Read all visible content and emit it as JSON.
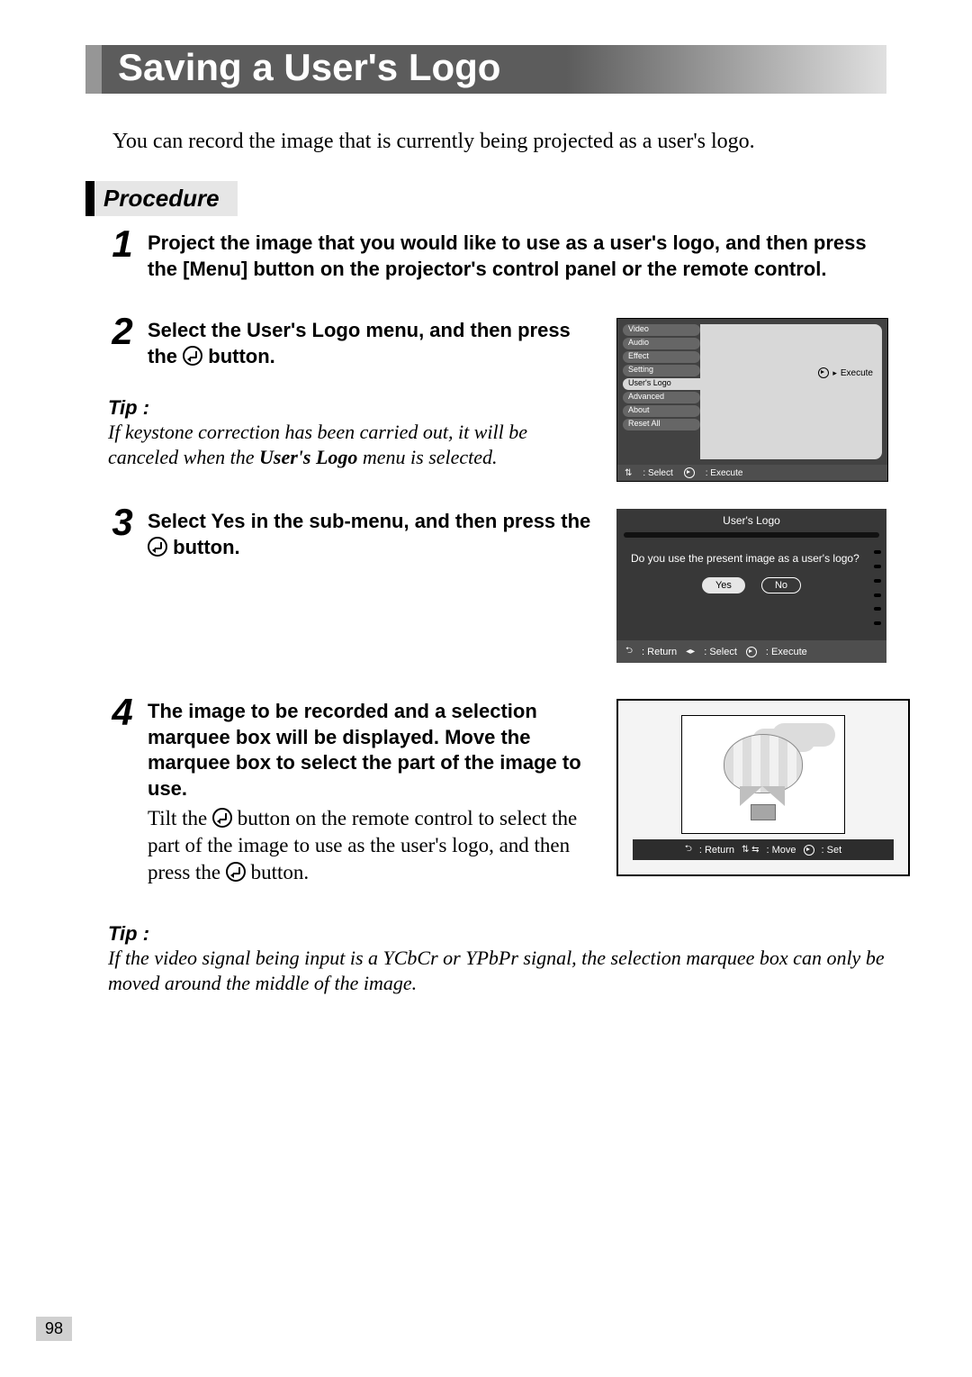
{
  "title": "Saving a User's Logo",
  "intro": "You can record the image that is currently being projected as a user's logo.",
  "procedure_label": "Procedure",
  "steps": {
    "s1": {
      "num": "1",
      "main": "Project the image that you would like to use as a user's logo, and then press the [Menu] button on the projector's control panel or the remote control."
    },
    "s2": {
      "num": "2",
      "main_a": "Select the User's Logo menu, and then press the ",
      "main_b": " button."
    },
    "s3": {
      "num": "3",
      "main_a": "Select Yes in the sub-menu, and then press the ",
      "main_b": " button."
    },
    "s4": {
      "num": "4",
      "main": "The image to be recorded and a selection marquee box will be displayed. Move the marquee box to select the part of the image to use.",
      "sub_a": "Tilt the ",
      "sub_b": " button on the remote control to select the part of the image to use as the user's logo, and then press the ",
      "sub_c": " button."
    }
  },
  "tips": {
    "label": "Tip :",
    "t1": "If keystone correction has been carried out, it will be canceled when the User's Logo menu is selected.",
    "t2": "If the video signal being input is a YCbCr or YPbPr signal, the selection marquee box can only be moved around the middle of the image."
  },
  "screen1": {
    "menu": [
      "Video",
      "Audio",
      "Effect",
      "Setting",
      "User's Logo",
      "Advanced",
      "About",
      "Reset All"
    ],
    "active_index": 4,
    "execute": "Execute",
    "footer_select": ": Select",
    "footer_execute": ": Execute"
  },
  "screen2": {
    "title": "User's Logo",
    "question": "Do you use the present image as a user's logo?",
    "yes": "Yes",
    "no": "No",
    "footer_return": ": Return",
    "footer_select": ": Select",
    "footer_execute": ": Execute"
  },
  "screen3": {
    "footer_return": ": Return",
    "footer_move": ": Move",
    "footer_set": ": Set"
  },
  "page_number": "98"
}
